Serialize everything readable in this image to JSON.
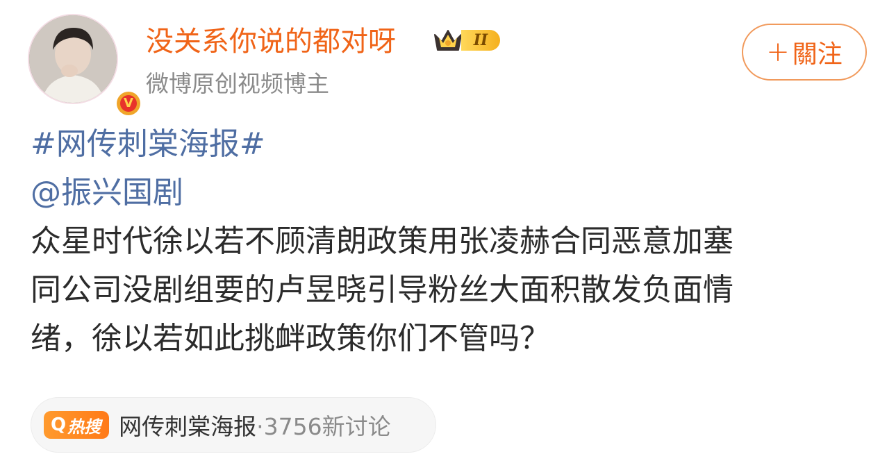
{
  "author": {
    "name": "没关系你说的都对呀",
    "level_badge": "II",
    "description": "微博原创视频博主",
    "verified_symbol": "V"
  },
  "follow_button": {
    "plus": "+",
    "label": "關注"
  },
  "post": {
    "hashtag": "#网传刺棠海报#",
    "mention": "@振兴国剧",
    "lines": [
      "众星时代徐以若不顾清朗政策用张凌赫合同恶意加塞",
      "同公司没剧组要的卢昱晓引导粉丝大面积散发负面情",
      "绪，徐以若如此挑衅政策你们不管吗？"
    ]
  },
  "topic_card": {
    "hot_label": "热搜",
    "hot_icon": "Q",
    "topic": "网传刺棠海报",
    "meta": "·3756新讨论"
  },
  "colors": {
    "username": "#f06418",
    "link": "#4f6ea3",
    "text": "#2b2b2b",
    "muted": "#8a8a8a",
    "hot_badge": "#ff8a22"
  }
}
